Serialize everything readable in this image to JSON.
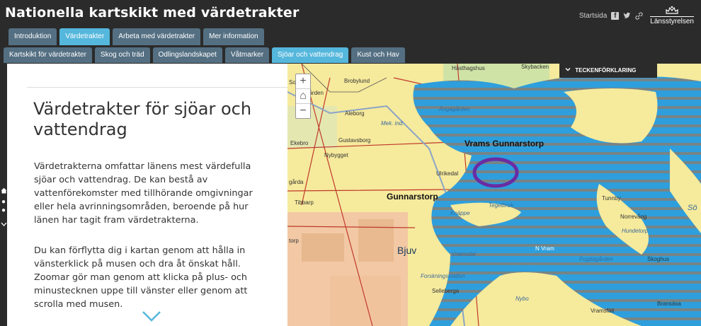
{
  "header": {
    "title": "Nationella kartskikt med värdetrakter",
    "links": {
      "startsida": "Startsida",
      "logo_text": "Länsstyrelsen"
    },
    "icons": [
      "facebook-icon",
      "twitter-icon",
      "link-icon",
      "crown-icon"
    ]
  },
  "tabs_top": [
    "Introduktion",
    "Värdetrakter",
    "Arbeta med värdetrakter",
    "Mer information"
  ],
  "tabs_top_active": "Värdetrakter",
  "tabs_sub": [
    "Kartskikt för värdetrakter",
    "Skog och träd",
    "Odlingslandskapet",
    "Våtmarker",
    "Sjöar och vattendrag",
    "Kust och Hav"
  ],
  "tabs_sub_active": "Sjöar och vattendrag",
  "panel": {
    "heading": "Värdetrakter för sjöar och vattendrag",
    "paragraph1": "Värdetrakterna omfattar länens mest värdefulla sjöar och vattendrag. De kan bestå av vattenförekomster med tillhörande omgivningar eller hela avrinningsområden, beroende på hur länen har tagit fram värdetrakterna.",
    "paragraph2": "Du kan förflytta dig i kartan genom att hålla in vänsterklick på musen och dra åt önskat håll. Zoomar gör man genom att klicka på plus- och minustecknen uppe till vänster eller genom att scrolla med musen."
  },
  "map": {
    "zoom_in": "+",
    "zoom_home": "⌂",
    "zoom_out": "−",
    "legend": "TECKENFÖRKLARING",
    "places": [
      {
        "name": "Hästhagshus",
        "cls": ""
      },
      {
        "name": "Brobylund",
        "cls": ""
      },
      {
        "name": "Aleborg",
        "cls": ""
      },
      {
        "name": "Mek. ind.",
        "cls": "water"
      },
      {
        "name": "Gustavsborg",
        "cls": ""
      },
      {
        "name": "Ekebro",
        "cls": ""
      },
      {
        "name": "Nybygget",
        "cls": ""
      },
      {
        "name": "Ängagården",
        "cls": "water"
      },
      {
        "name": "Vrams Gunnarstorp",
        "cls": "big"
      },
      {
        "name": "Ulrikedal",
        "cls": ""
      },
      {
        "name": "Gunnarstorp",
        "cls": "big"
      },
      {
        "name": "Tibbarp",
        "cls": ""
      },
      {
        "name": "Knäppe",
        "cls": "water"
      },
      {
        "name": "Tunnby",
        "cls": ""
      },
      {
        "name": "Norrevång",
        "cls": ""
      },
      {
        "name": "Hundetorp",
        "cls": "water"
      },
      {
        "name": "Bjuv",
        "cls": "bigblue"
      },
      {
        "name": "N Vram",
        "cls": ""
      },
      {
        "name": "Vramsdal",
        "cls": "water"
      },
      {
        "name": "Fogdagården",
        "cls": "water"
      },
      {
        "name": "Skoghus",
        "cls": ""
      },
      {
        "name": "Forskningsstation",
        "cls": "water"
      },
      {
        "name": "Selleberga",
        "cls": ""
      },
      {
        "name": "Nybo",
        "cls": "water"
      },
      {
        "name": "Vramsfält",
        "cls": ""
      },
      {
        "name": "Bransäsa",
        "cls": ""
      },
      {
        "name": "Sö",
        "cls": "water"
      },
      {
        "name": "Skybacken",
        "cls": ""
      },
      {
        "name": "Sol",
        "cls": ""
      },
      {
        "name": "gården",
        "cls": ""
      },
      {
        "name": "gårda",
        "cls": ""
      },
      {
        "name": "torp",
        "cls": ""
      },
      {
        "name": "Tegelbruk",
        "cls": "water"
      }
    ]
  },
  "colors": {
    "header_bg": "#2b2b2b",
    "tab": "#546f82",
    "tab_active": "#55b7dc",
    "water_zone": "#2e9fdc",
    "stripe": "#8d7a6a",
    "land": "#f6ea9c",
    "marker": "#6a2ca3"
  }
}
